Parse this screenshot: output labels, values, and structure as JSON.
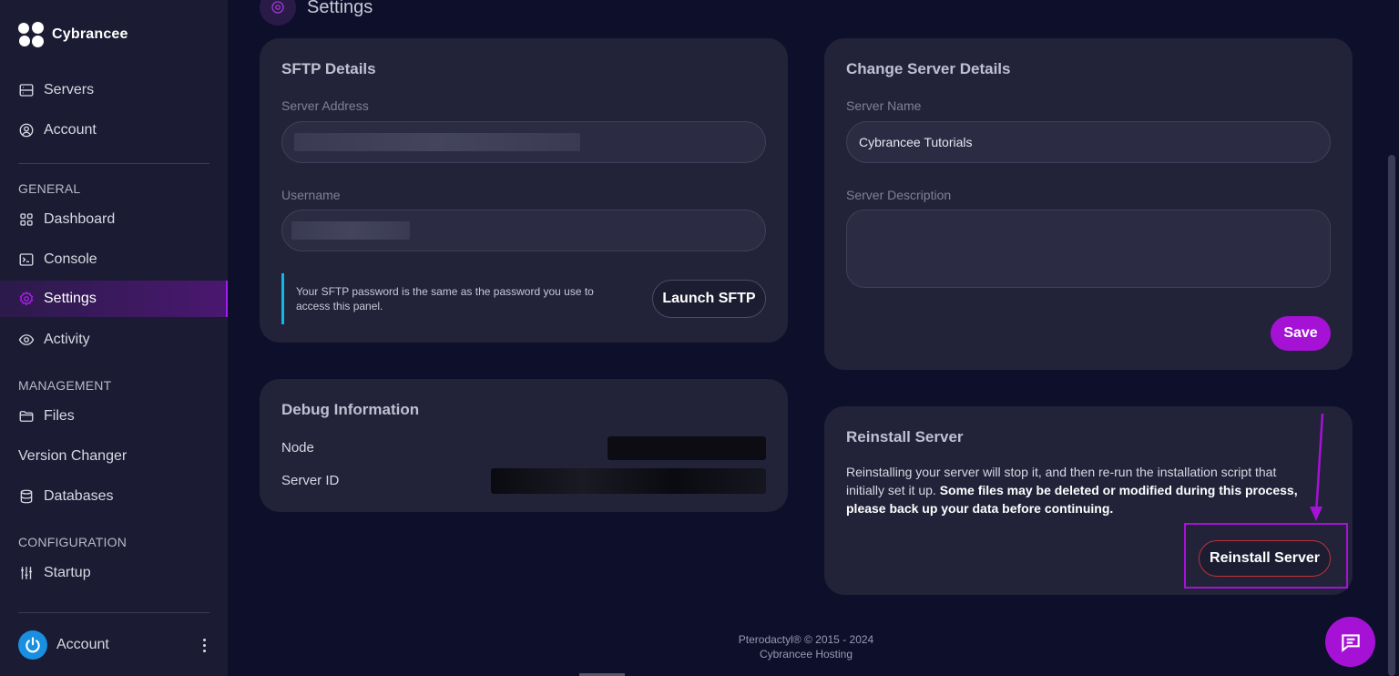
{
  "brand": {
    "name": "Cybrancee"
  },
  "sidebar": {
    "top_items": [
      {
        "label": "Servers",
        "icon": "server-icon"
      },
      {
        "label": "Account",
        "icon": "user-circle-icon"
      }
    ],
    "sections": [
      {
        "label": "GENERAL",
        "items": [
          {
            "label": "Dashboard",
            "icon": "grid-icon"
          },
          {
            "label": "Console",
            "icon": "terminal-icon"
          },
          {
            "label": "Settings",
            "icon": "gear-icon",
            "active": true
          },
          {
            "label": "Activity",
            "icon": "eye-icon"
          }
        ]
      },
      {
        "label": "MANAGEMENT",
        "items": [
          {
            "label": "Files",
            "icon": "folder-icon"
          },
          {
            "label": "Version Changer",
            "icon": ""
          },
          {
            "label": "Databases",
            "icon": "database-icon"
          }
        ]
      },
      {
        "label": "CONFIGURATION",
        "items": [
          {
            "label": "Startup",
            "icon": "sliders-icon"
          }
        ]
      }
    ],
    "account_label": "Account"
  },
  "header": {
    "title": "Settings"
  },
  "sftp": {
    "title": "SFTP Details",
    "address_label": "Server Address",
    "username_label": "Username",
    "info_text": "Your SFTP password is the same as the password you use to access this panel.",
    "launch_label": "Launch SFTP"
  },
  "debug": {
    "title": "Debug Information",
    "node_label": "Node",
    "server_id_label": "Server ID"
  },
  "change_details": {
    "title": "Change Server Details",
    "name_label": "Server Name",
    "name_value": "Cybrancee Tutorials",
    "description_label": "Server Description",
    "description_value": "",
    "save_label": "Save"
  },
  "reinstall": {
    "title": "Reinstall Server",
    "text_plain": "Reinstalling your server will stop it, and then re-run the installation script that initially set it up. ",
    "text_bold": "Some files may be deleted or modified during this process, please back up your data before continuing.",
    "button_label": "Reinstall Server"
  },
  "footer": {
    "line1": "Pterodactyl® © 2015 - 2024",
    "line2": "Cybrancee Hosting"
  },
  "colors": {
    "accent": "#a512d6",
    "info_border": "#10b8e8",
    "danger_border": "#c0303a",
    "background": "#0e0f2a",
    "card": "#222339"
  }
}
